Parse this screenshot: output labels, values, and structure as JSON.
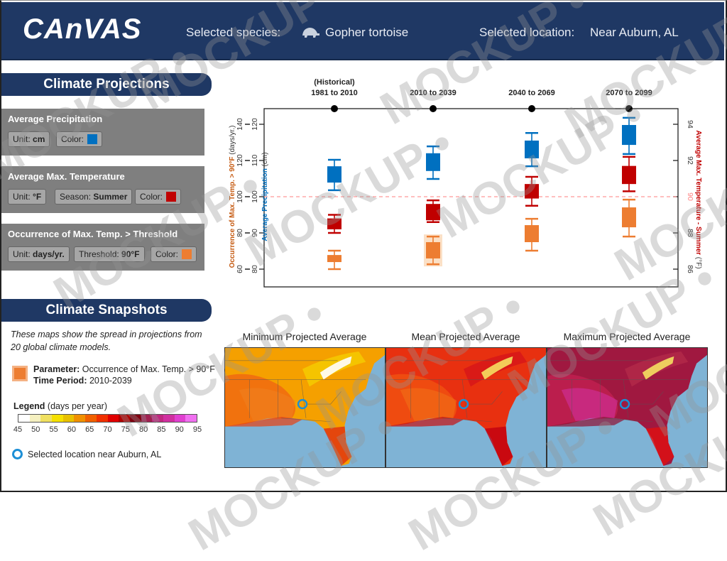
{
  "header": {
    "app_title": "CAnVAS",
    "species_label": "Selected species:",
    "species_icon": "tortoise-icon",
    "species_value": "Gopher tortoise",
    "location_label": "Selected location:",
    "location_value": "Near Auburn, AL"
  },
  "projections": {
    "title": "Climate Projections",
    "panels": [
      {
        "title": "Average Precipitation",
        "chips": [
          {
            "label": "Unit: ",
            "value": "cm"
          },
          {
            "label": "Color:",
            "color": "#0070c0"
          }
        ]
      },
      {
        "title": "Average Max. Temperature",
        "chips": [
          {
            "label": "Unit: ",
            "value": "°F"
          },
          {
            "label": "Season: ",
            "value": "Summer"
          },
          {
            "label": "Color:",
            "color": "#c00000"
          }
        ]
      },
      {
        "title": "Occurrence of Max. Temp. > Threshold",
        "chips": [
          {
            "label": "Unit: ",
            "value": "days/yr."
          },
          {
            "label": "Threshold: ",
            "value": "90°F"
          },
          {
            "label": "Color:",
            "color": "#ed7d31"
          }
        ]
      }
    ]
  },
  "snapshots": {
    "title": "Climate Snapshots",
    "description": "These maps show the spread in projections from 20 global climate models.",
    "parameter_label": "Parameter:",
    "parameter_value": " Occurrence of Max. Temp. > 90°F",
    "period_label": "Time Period:",
    "period_value": " 2010-2039",
    "legend_title": "Legend",
    "legend_unit": " (days per year)",
    "legend_ticks": [
      "45",
      "50",
      "55",
      "60",
      "65",
      "70",
      "75",
      "80",
      "85",
      "90",
      "95"
    ],
    "legend_colors": [
      "#ffffff",
      "#f5f0c0",
      "#f0e060",
      "#f5e000",
      "#e8c000",
      "#f09000",
      "#f06000",
      "#f03000",
      "#e00000",
      "#b00000",
      "#800010",
      "#a02050",
      "#c02880",
      "#d030a0",
      "#e040d0",
      "#f070f0"
    ],
    "location_legend": "Selected location near Auburn, AL",
    "maps": [
      {
        "title": "Minimum Projected Average",
        "palette": "min"
      },
      {
        "title": "Mean Projected Average",
        "palette": "mean"
      },
      {
        "title": "Maximum Projected Average",
        "palette": "max"
      }
    ]
  },
  "chart_data": {
    "type": "boxplot",
    "categories": [
      "(Historical)\n1981 to 2010",
      "2010 to 2039",
      "2040 to 2069",
      "2070 to 2099"
    ],
    "category_labels": [
      {
        "line1": "(Historical)",
        "line2": "1981 to 2010"
      },
      {
        "line1": "",
        "line2": "2010 to 2039"
      },
      {
        "line1": "",
        "line2": "2040 to 2069"
      },
      {
        "line1": "",
        "line2": "2070 to 2099"
      }
    ],
    "axes": {
      "occurrence": {
        "label_prefix": "Occurrence of Max. Temp. > 90°F",
        "label_suffix": " (days/yr.)",
        "range": [
          60,
          140
        ],
        "ticks": [
          60,
          80,
          100,
          120,
          140
        ],
        "color": "#c55a11"
      },
      "precipitation": {
        "label_prefix": "Average Precipitation",
        "label_suffix": " (cm)",
        "range": [
          80,
          120
        ],
        "ticks": [
          80,
          90,
          100,
          110,
          120
        ],
        "color": "#0070c0"
      },
      "temperature": {
        "label_prefix": "Average Max. Temperature - Summer",
        "label_suffix": " (°F)",
        "range": [
          86,
          94
        ],
        "ticks": [
          86,
          88,
          90,
          92,
          94
        ],
        "highlight_tick": 90,
        "color": "#c00000",
        "highlight_color": "#ff7f7f"
      }
    },
    "reference_line": {
      "axis": "temperature",
      "value": 90,
      "style": "dashed",
      "color": "#ff7f7f"
    },
    "series": [
      {
        "name": "Average Precipitation",
        "axis": "precipitation",
        "color": "#0070c0",
        "boxes": [
          {
            "whisker_low": 101.8,
            "q1": 103.9,
            "q3": 108.4,
            "whisker_high": 110.2
          },
          {
            "whisker_low": 104.9,
            "q1": 107.1,
            "q3": 112.0,
            "whisker_high": 113.9
          },
          {
            "whisker_low": 108.4,
            "q1": 110.6,
            "q3": 115.5,
            "whisker_high": 117.6
          },
          {
            "whisker_low": 111.8,
            "q1": 114.3,
            "q3": 119.8,
            "whisker_high": 121.8
          }
        ]
      },
      {
        "name": "Average Max. Temperature - Summer",
        "axis": "temperature",
        "color": "#c00000",
        "boxes": [
          {
            "whisker_low": 88.0,
            "q1": 88.2,
            "q3": 88.8,
            "whisker_high": 89.0
          },
          {
            "whisker_low": 88.6,
            "q1": 88.7,
            "q3": 89.6,
            "whisker_high": 89.8
          },
          {
            "whisker_low": 89.5,
            "q1": 89.9,
            "q3": 90.7,
            "whisker_high": 91.1
          },
          {
            "whisker_low": 90.3,
            "q1": 90.7,
            "q3": 91.7,
            "whisker_high": 92.2
          }
        ]
      },
      {
        "name": "Occurrence of Max. Temp. > 90°F",
        "axis": "occurrence",
        "color": "#ed7d31",
        "boxes": [
          {
            "whisker_low": 60.0,
            "q1": 63.9,
            "q3": 67.8,
            "whisker_high": 70.2
          },
          {
            "whisker_low": 62.7,
            "q1": 65.9,
            "q3": 74.9,
            "whisker_high": 78.0,
            "highlighted": true
          },
          {
            "whisker_low": 70.2,
            "q1": 74.9,
            "q3": 84.3,
            "whisker_high": 87.8
          },
          {
            "whisker_low": 78.0,
            "q1": 83.1,
            "q3": 94.1,
            "whisker_high": 98.4
          }
        ]
      }
    ]
  },
  "watermark": "MOCKUP •"
}
